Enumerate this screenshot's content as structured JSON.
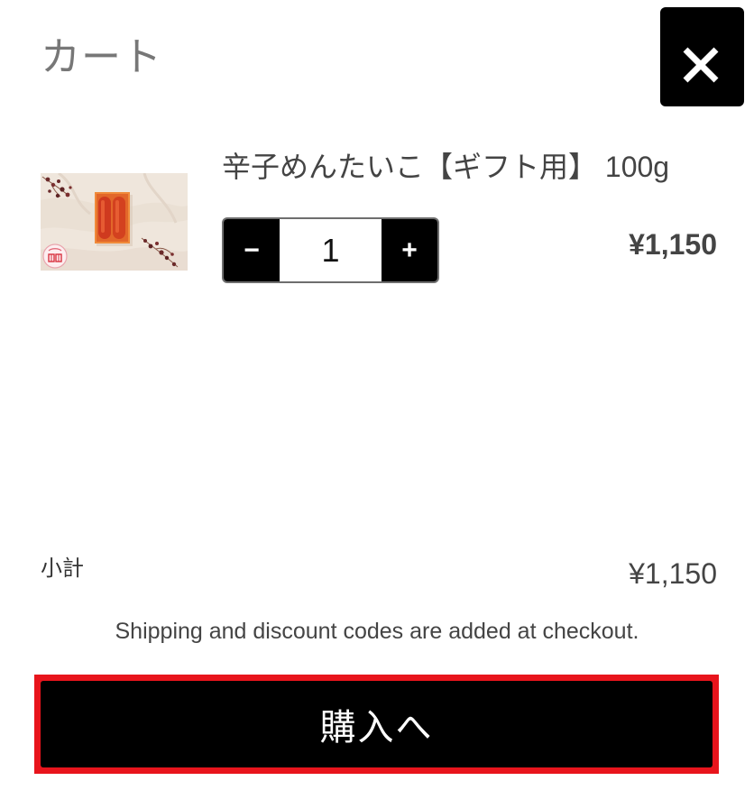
{
  "cart": {
    "title": "カート"
  },
  "close": {
    "icon": "close-icon"
  },
  "item": {
    "title": "辛子めんたいこ【ギフト用】 100g",
    "image_icon": "product-image",
    "decrement_label": "−",
    "quantity": "1",
    "increment_label": "+",
    "price": "¥1,150"
  },
  "summary": {
    "subtotal_label": "小計",
    "subtotal_value": "¥1,150",
    "note": "Shipping and discount codes are added at checkout."
  },
  "checkout": {
    "label": "購入へ"
  },
  "colors": {
    "primary": "#000000",
    "checkout_outline": "#e8141c",
    "text": "#444444",
    "title": "#777777",
    "background": "#ffffff"
  }
}
